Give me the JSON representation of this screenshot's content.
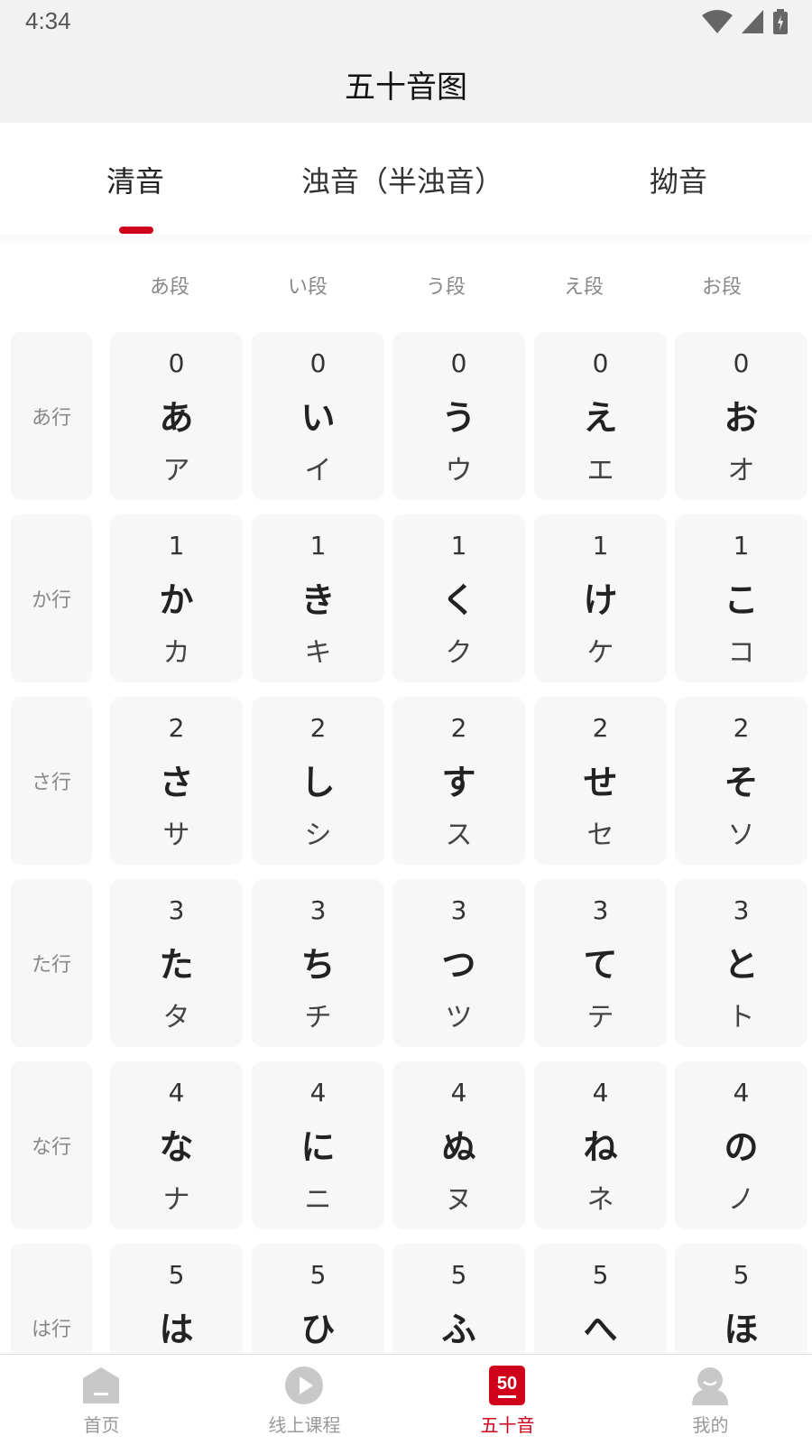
{
  "status_bar": {
    "time": "4:34"
  },
  "header": {
    "title": "五十音图"
  },
  "tabs": [
    {
      "label": "清音",
      "active": true
    },
    {
      "label": "浊音（半浊音）",
      "active": false
    },
    {
      "label": "拗音",
      "active": false
    }
  ],
  "columns": [
    "あ段",
    "い段",
    "う段",
    "え段",
    "お段"
  ],
  "rows": [
    {
      "label": "あ行",
      "cells": [
        {
          "count": "0",
          "hira": "あ",
          "kata": "ア"
        },
        {
          "count": "0",
          "hira": "い",
          "kata": "イ"
        },
        {
          "count": "0",
          "hira": "う",
          "kata": "ウ"
        },
        {
          "count": "0",
          "hira": "え",
          "kata": "エ"
        },
        {
          "count": "0",
          "hira": "お",
          "kata": "オ"
        }
      ]
    },
    {
      "label": "か行",
      "cells": [
        {
          "count": "1",
          "hira": "か",
          "kata": "カ"
        },
        {
          "count": "1",
          "hira": "き",
          "kata": "キ"
        },
        {
          "count": "1",
          "hira": "く",
          "kata": "ク"
        },
        {
          "count": "1",
          "hira": "け",
          "kata": "ケ"
        },
        {
          "count": "1",
          "hira": "こ",
          "kata": "コ"
        }
      ]
    },
    {
      "label": "さ行",
      "cells": [
        {
          "count": "2",
          "hira": "さ",
          "kata": "サ"
        },
        {
          "count": "2",
          "hira": "し",
          "kata": "シ"
        },
        {
          "count": "2",
          "hira": "す",
          "kata": "ス"
        },
        {
          "count": "2",
          "hira": "せ",
          "kata": "セ"
        },
        {
          "count": "2",
          "hira": "そ",
          "kata": "ソ"
        }
      ]
    },
    {
      "label": "た行",
      "cells": [
        {
          "count": "3",
          "hira": "た",
          "kata": "タ"
        },
        {
          "count": "3",
          "hira": "ち",
          "kata": "チ"
        },
        {
          "count": "3",
          "hira": "つ",
          "kata": "ツ"
        },
        {
          "count": "3",
          "hira": "て",
          "kata": "テ"
        },
        {
          "count": "3",
          "hira": "と",
          "kata": "ト"
        }
      ]
    },
    {
      "label": "な行",
      "cells": [
        {
          "count": "4",
          "hira": "な",
          "kata": "ナ"
        },
        {
          "count": "4",
          "hira": "に",
          "kata": "ニ"
        },
        {
          "count": "4",
          "hira": "ぬ",
          "kata": "ヌ"
        },
        {
          "count": "4",
          "hira": "ね",
          "kata": "ネ"
        },
        {
          "count": "4",
          "hira": "の",
          "kata": "ノ"
        }
      ]
    },
    {
      "label": "は行",
      "cells": [
        {
          "count": "5",
          "hira": "は",
          "kata": ""
        },
        {
          "count": "5",
          "hira": "ひ",
          "kata": ""
        },
        {
          "count": "5",
          "hira": "ふ",
          "kata": ""
        },
        {
          "count": "5",
          "hira": "へ",
          "kata": ""
        },
        {
          "count": "5",
          "hira": "ほ",
          "kata": ""
        }
      ]
    }
  ],
  "bottom_nav": [
    {
      "label": "首页",
      "icon": "home-icon",
      "active": false
    },
    {
      "label": "线上课程",
      "icon": "play-icon",
      "active": false
    },
    {
      "label": "五十音",
      "icon": "fifty-icon",
      "icon_text": "50",
      "active": true
    },
    {
      "label": "我的",
      "icon": "profile-icon",
      "active": false
    }
  ],
  "colors": {
    "accent": "#d0021b",
    "inactive_icon": "#c8c8c8",
    "cell_bg": "#f7f7f7"
  }
}
